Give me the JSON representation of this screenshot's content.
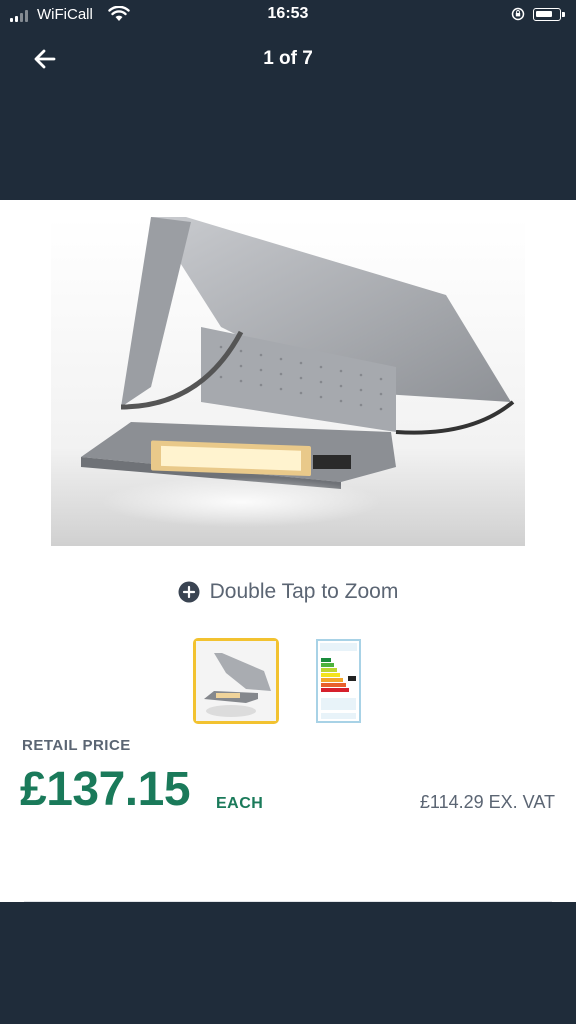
{
  "status_bar": {
    "carrier": "WiFiCall",
    "time": "16:53",
    "icons": [
      "signal-icon",
      "wifi-icon",
      "orientation-lock-icon",
      "battery-icon"
    ],
    "battery_level": 0.75
  },
  "header": {
    "back_icon": "arrow-left-icon",
    "page_counter": "1 of 7"
  },
  "gallery": {
    "main_image": "cooker-hood-image",
    "zoom_hint": "Double Tap to Zoom",
    "zoom_icon": "plus-circle-icon",
    "thumbnails": [
      {
        "name": "cooker-hood-thumbnail",
        "selected": true
      },
      {
        "name": "energy-label-thumbnail",
        "selected": false
      }
    ]
  },
  "pricing": {
    "label": "RETAIL PRICE",
    "price": "£137.15",
    "unit": "EACH",
    "ex_vat_price": "£114.29",
    "ex_vat_label": "EX. VAT"
  },
  "colors": {
    "background_dark": "#1f2c3a",
    "price_green": "#1a7a5a",
    "selected_border": "#f2c230",
    "muted_text": "#5b6573"
  }
}
